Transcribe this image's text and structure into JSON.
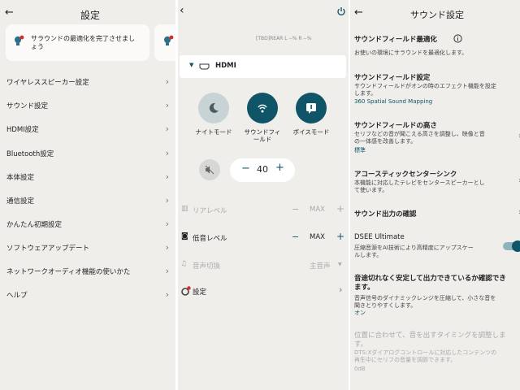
{
  "settings_screen": {
    "title": "設定",
    "back_icon": "arrow-left-icon",
    "notification": {
      "text_line1": "サラウンドの最適化を完了させまし",
      "text_line2": "ょう",
      "icon": "bulb-alert-icon"
    },
    "menu_items": [
      {
        "label": "ワイヤレススピーカー設定"
      },
      {
        "label": "サウンド設定"
      },
      {
        "label": "HDMI設定"
      },
      {
        "label": "Bluetooth設定"
      },
      {
        "label": "本体設定"
      },
      {
        "label": "通信設定"
      },
      {
        "label": "かんたん初期設定"
      },
      {
        "label": "ソフトウェアアップデート"
      },
      {
        "label": "ネットワークオーディオ機能の使いかた"
      },
      {
        "label": "ヘルプ"
      }
    ]
  },
  "control_screen": {
    "status_line": "[TBD]REAR L --% R --%",
    "input_source": "HDMI",
    "modes": [
      {
        "label_line1": "ナイトモード",
        "label_line2": "",
        "active": false,
        "icon": "night-mode-icon"
      },
      {
        "label_line1": "サウンドフィ",
        "label_line2": "ールド",
        "active": true,
        "icon": "sound-field-icon"
      },
      {
        "label_line1": "ボイスモード",
        "label_line2": "",
        "active": true,
        "icon": "voice-mode-icon"
      }
    ],
    "volume": {
      "value": "40",
      "minus": "−",
      "plus": "+"
    },
    "rear_level": {
      "label": "リアレベル",
      "value": "MAX",
      "enabled": false
    },
    "bass_level": {
      "label": "低音レベル",
      "value": "MAX",
      "enabled": true
    },
    "audio_switch": {
      "label": "音声切換",
      "value": "主音声",
      "enabled": false
    },
    "settings_link": {
      "label": "設定"
    }
  },
  "sound_settings_screen": {
    "title": "サウンド設定",
    "sections": [
      {
        "title": "サウンドフィールド最適化",
        "desc": "お使いの環境にサラウンドを最適化します。",
        "link": ""
      },
      {
        "title": "サウンドフィールド設定",
        "desc": "サウンドフィールドがオンの時のエフェクト機能を設定\nします。",
        "link": "360 Spatial Sound Mapping"
      },
      {
        "title": "サウンドフィールドの高さ",
        "desc": "セリフなどの音が聞こえる高さを調整し、映像と音\nの一体感を改善します。",
        "link": "標準"
      },
      {
        "title": "アコースティックセンターシンク",
        "desc": "本機能に対応したテレビをセンタースピーカーとし\nて使います。",
        "link": ""
      },
      {
        "title": "サウンド出力の確認",
        "desc": "",
        "link": ""
      },
      {
        "title": "DSEE Ultimate",
        "desc": "圧縮音源をAI技術により高精度にアップスケー\nルします。",
        "link": ""
      },
      {
        "title": "音途切れなく安定して出力できているか確認でき\nます。",
        "desc": "音声信号のダイナミックレンジを圧縮して、小さな音を\n聞きとりやすくします。",
        "link": "オン"
      },
      {
        "title": "",
        "desc": "位置に合わせて、音を出すタイミングを調整しま\nす。",
        "link": ""
      },
      {
        "title": "",
        "desc": "DTS:Xダイアログコントロールに対応したコンテンツの\n再生中にセリフの音量を調節できます。",
        "link": "0dB"
      }
    ]
  }
}
